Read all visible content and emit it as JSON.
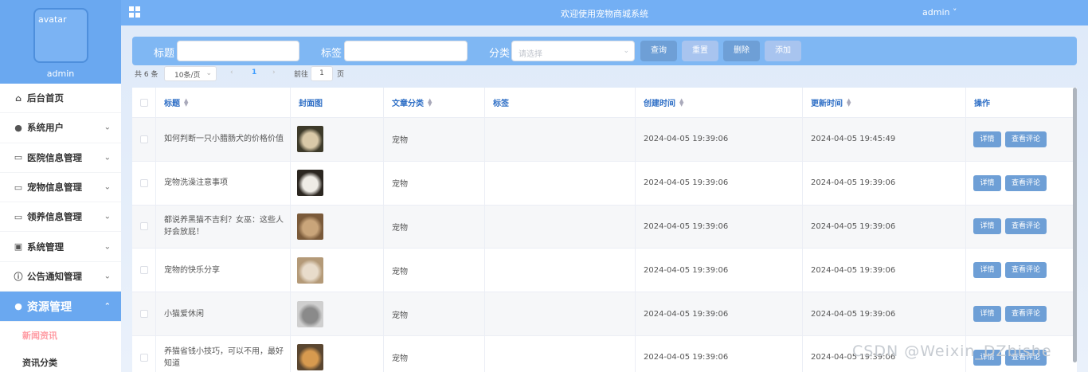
{
  "sidebar": {
    "avatar_alt": "avatar",
    "username": "admin",
    "items": [
      {
        "label": "后台首页",
        "icon": "home-icon"
      },
      {
        "label": "系统用户",
        "icon": "user-icon"
      },
      {
        "label": "医院信息管理",
        "icon": "document-icon"
      },
      {
        "label": "宠物信息管理",
        "icon": "document-icon"
      },
      {
        "label": "领养信息管理",
        "icon": "document-icon"
      },
      {
        "label": "系统管理",
        "icon": "picture-icon"
      },
      {
        "label": "公告通知管理",
        "icon": "info-icon"
      },
      {
        "label": "资源管理",
        "icon": "location-icon"
      }
    ],
    "subitems": [
      {
        "label": "新闻资讯"
      },
      {
        "label": "资讯分类"
      }
    ]
  },
  "header": {
    "title": "欢迎使用宠物商城系统",
    "user": "admin"
  },
  "search": {
    "title_label": "标题",
    "tag_label": "标签",
    "category_label": "分类",
    "category_placeholder": "请选择",
    "query_btn": "查询",
    "reset_btn": "重置",
    "delete_btn": "删除",
    "add_btn": "添加"
  },
  "pager": {
    "total": "共 6 条",
    "page_size": "10条/页",
    "current_page": "1",
    "goto_label": "前往",
    "goto_value": "1",
    "page_unit": "页"
  },
  "table": {
    "headers": [
      "标题",
      "封面图",
      "文章分类",
      "标签",
      "创建时间",
      "更新时间",
      "操作"
    ],
    "rows": [
      {
        "title": "如何判断一只小腊肠犬的价格价值",
        "category": "宠物",
        "tag": "",
        "created": "2024-04-05 19:39:06",
        "updated": "2024-04-05 19:45:49",
        "detail": "详情",
        "comments": "查看评论"
      },
      {
        "title": "宠物洗澡注意事项",
        "category": "宠物",
        "tag": "",
        "created": "2024-04-05 19:39:06",
        "updated": "2024-04-05 19:39:06",
        "detail": "详情",
        "comments": "查看评论"
      },
      {
        "title": "都说养黑猫不吉利？女巫：这些人好会放屁！",
        "category": "宠物",
        "tag": "",
        "created": "2024-04-05 19:39:06",
        "updated": "2024-04-05 19:39:06",
        "detail": "详情",
        "comments": "查看评论"
      },
      {
        "title": "宠物的快乐分享",
        "category": "宠物",
        "tag": "",
        "created": "2024-04-05 19:39:06",
        "updated": "2024-04-05 19:39:06",
        "detail": "详情",
        "comments": "查看评论"
      },
      {
        "title": "小猫爱休闲",
        "category": "宠物",
        "tag": "",
        "created": "2024-04-05 19:39:06",
        "updated": "2024-04-05 19:39:06",
        "detail": "详情",
        "comments": "查看评论"
      },
      {
        "title": "养猫省钱小技巧，可以不用，最好知道",
        "category": "宠物",
        "tag": "",
        "created": "2024-04-05 19:39:06",
        "updated": "2024-04-05 19:39:06",
        "detail": "详情",
        "comments": "查看评论"
      }
    ]
  },
  "watermark": "CSDN @Weixin_DZbishe",
  "colors": {
    "primary": "#73aff4",
    "button": "#6e9fd6",
    "active_sub": "#ff9aa2"
  }
}
